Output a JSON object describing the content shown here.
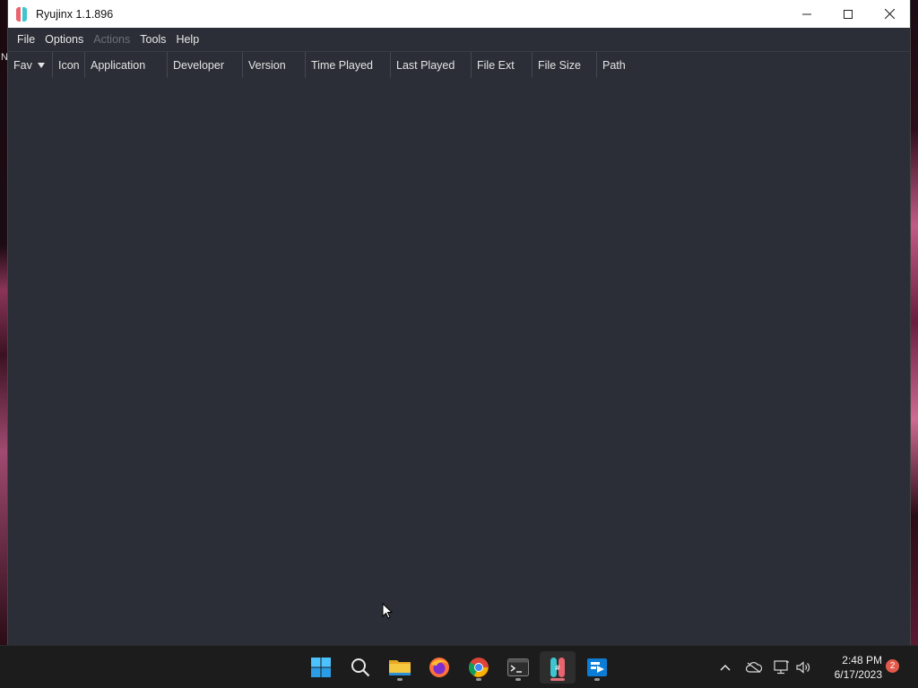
{
  "window": {
    "title": "Ryujinx 1.1.896",
    "controls": {
      "minimize": "minimize-icon",
      "maximize": "maximize-icon",
      "close": "close-icon"
    }
  },
  "menubar": {
    "items": [
      {
        "label": "File",
        "enabled": true
      },
      {
        "label": "Options",
        "enabled": true
      },
      {
        "label": "Actions",
        "enabled": false
      },
      {
        "label": "Tools",
        "enabled": true
      },
      {
        "label": "Help",
        "enabled": true
      }
    ]
  },
  "game_list": {
    "columns": [
      {
        "label": "Fav",
        "sorted": "descending"
      },
      {
        "label": "Icon"
      },
      {
        "label": "Application"
      },
      {
        "label": "Developer"
      },
      {
        "label": "Version"
      },
      {
        "label": "Time Played"
      },
      {
        "label": "Last Played"
      },
      {
        "label": "File Ext"
      },
      {
        "label": "File Size"
      },
      {
        "label": "Path"
      }
    ],
    "rows": []
  },
  "desktop": {
    "partial_letter": "N"
  },
  "taskbar": {
    "apps": [
      {
        "name": "start-icon"
      },
      {
        "name": "search-icon"
      },
      {
        "name": "file-explorer-icon",
        "running": true
      },
      {
        "name": "firefox-icon"
      },
      {
        "name": "chrome-icon",
        "running": true
      },
      {
        "name": "terminal-icon",
        "running": true
      },
      {
        "name": "ryujinx-icon",
        "running": true,
        "active": true
      },
      {
        "name": "remote-desktop-icon",
        "running": true
      }
    ],
    "tray": {
      "icons": [
        "chevron-up-icon",
        "onedrive-offline-icon",
        "network-icon",
        "volume-icon"
      ],
      "time": "2:48 PM",
      "date": "6/17/2023",
      "notification_count": "2"
    }
  },
  "colors": {
    "window_bg": "#2b2e36",
    "taskbar_bg": "#1c1c1c",
    "accent_red": "#e8646e",
    "accent_cyan": "#3ec5cf"
  }
}
